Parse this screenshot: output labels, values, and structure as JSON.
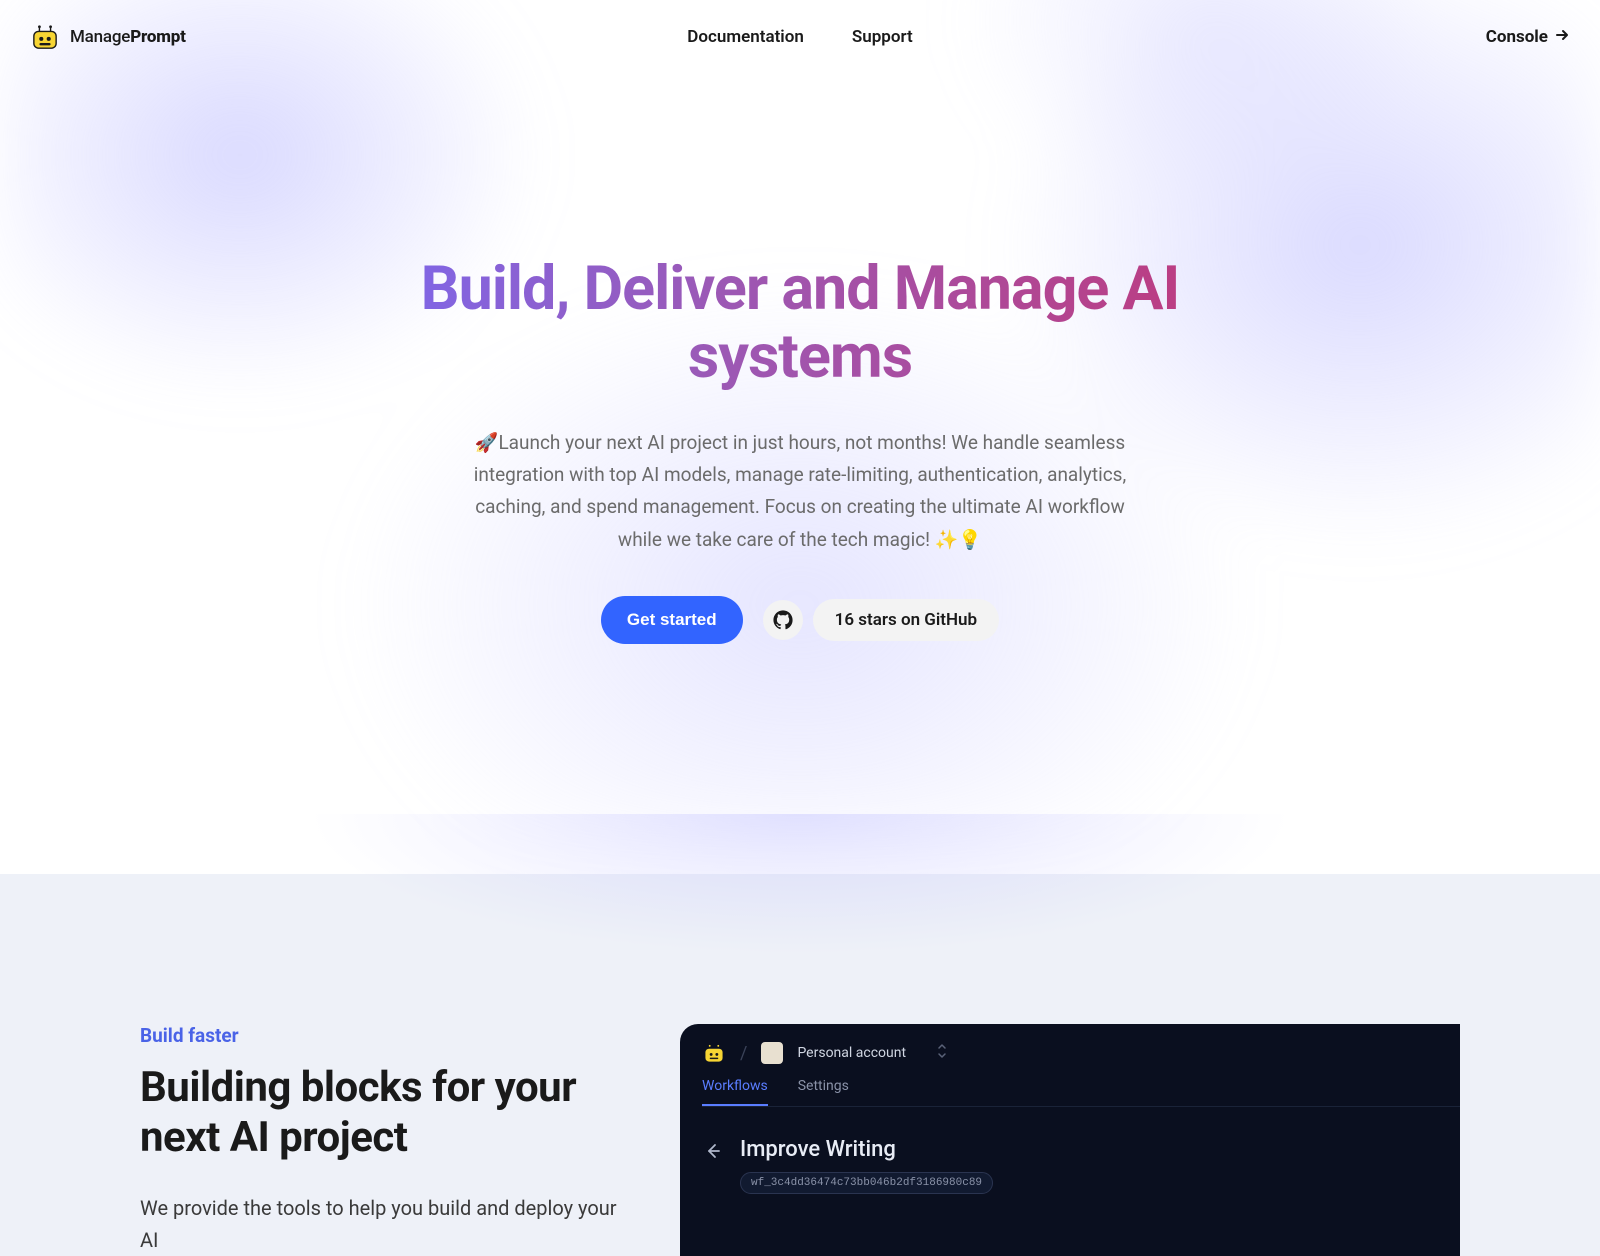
{
  "brand": {
    "name_plain": "Manage",
    "name_bold": "Prompt"
  },
  "nav": {
    "documentation": "Documentation",
    "support": "Support",
    "console": "Console"
  },
  "hero": {
    "headline": "Build, Deliver and Manage AI systems",
    "sub": "🚀Launch your next AI project in just hours, not months! We handle seamless integration with top AI models, manage rate-limiting, authentication, analytics, caching, and spend management. Focus on creating the ultimate AI workflow while we take care of the tech magic! ✨💡",
    "cta_primary": "Get started",
    "stars_text": "16 stars on GitHub"
  },
  "section2": {
    "eyebrow": "Build faster",
    "heading": "Building blocks for your next AI project",
    "body": "We provide the tools to help you build and deploy your AI"
  },
  "app": {
    "account": "Personal account",
    "tabs": {
      "workflows": "Workflows",
      "settings": "Settings"
    },
    "workflow_title": "Improve Writing",
    "workflow_id": "wf_3c4dd36474c73bb046b2df3186980c89"
  }
}
